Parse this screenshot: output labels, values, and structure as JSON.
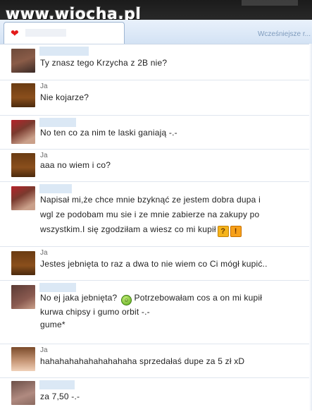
{
  "watermark": "www.wiocha.pl",
  "tab": {
    "icon": "heart-icon",
    "older_link": "Wcześniejsze r..."
  },
  "messages": [
    {
      "sender": "other",
      "lines": [
        "Ty znasz tego Krzycha z 2B nie?"
      ]
    },
    {
      "sender": "Ja",
      "lines": [
        "Nie kojarze?"
      ]
    },
    {
      "sender": "other",
      "lines": [
        "No ten co za nim te laski ganiają -.-"
      ]
    },
    {
      "sender": "Ja",
      "lines": [
        "aaa no wiem i co?"
      ]
    },
    {
      "sender": "other",
      "lines": [
        "Napisał mi,że chce mnie bzyknąć ze jestem dobra dupa i",
        "wgl ze podobam mu sie i ze mnie zabierze na zakupy po",
        "wszystkim.I się zgodziłam a wiesz co mi kupił"
      ]
    },
    {
      "sender": "Ja",
      "lines": [
        "Jestes jebnięta to raz a dwa to nie wiem co Ci mógł kupić.."
      ]
    },
    {
      "sender": "other",
      "lines": [
        "No ej jaka jebnięta?",
        "Potrzebowałam cos a on mi kupił",
        "kurwa chipsy i gumo orbit -.-",
        "gume*"
      ]
    },
    {
      "sender": "Ja",
      "lines": [
        "hahahahahahahahahaha sprzedałaś dupe za 5 zł xD"
      ]
    },
    {
      "sender": "other",
      "lines": [
        "za 7,50 -.-"
      ]
    }
  ],
  "colors": {
    "accent": "#dbe8f5",
    "tab_border": "#9fb6d2"
  }
}
